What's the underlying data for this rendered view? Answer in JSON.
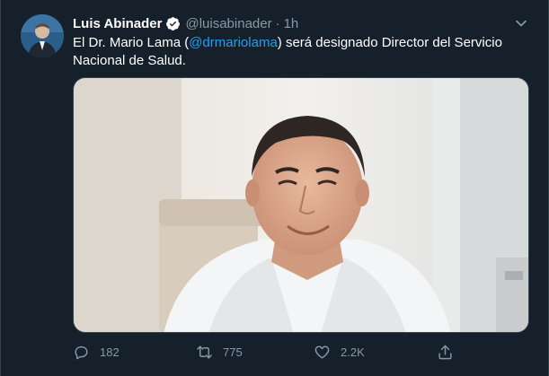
{
  "tweet": {
    "author_name": "Luis Abinader",
    "handle": "@luisabinader",
    "separator": "·",
    "time": "1h",
    "text_before": "El Dr. Mario Lama (",
    "mention": "@drmariolama",
    "text_after": ") será designado Director del Servicio Nacional de Salud.",
    "replies": "182",
    "retweets": "775",
    "likes": "2.2K"
  },
  "icons": {
    "verified": "verified-badge-icon",
    "more": "chevron-down-icon",
    "reply": "reply-icon",
    "retweet": "retweet-icon",
    "like": "heart-icon",
    "share": "share-icon"
  },
  "colors": {
    "background": "#15202b",
    "accent": "#1da1f2",
    "muted": "#8899a6",
    "border": "#38444d"
  }
}
